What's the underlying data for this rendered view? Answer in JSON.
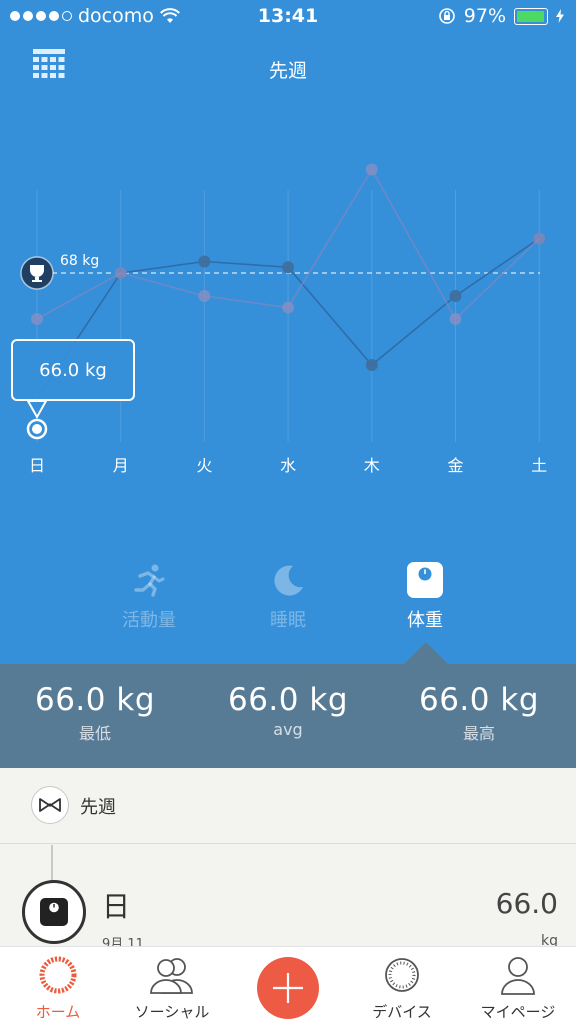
{
  "status_bar": {
    "carrier": "docomo",
    "time": "13:41",
    "battery": "97%",
    "battery_level": 0.97
  },
  "header": {
    "title": "先週",
    "calendar_icon": "calendar-grid-icon"
  },
  "chart_data": {
    "type": "line",
    "categories": [
      "日",
      "月",
      "火",
      "水",
      "木",
      "金",
      "土"
    ],
    "series": [
      {
        "values": [
          null,
          66.3,
          66.4,
          66.35,
          65.5,
          66.1,
          66.6
        ]
      },
      {
        "values": [
          65.9,
          66.3,
          66.1,
          66.0,
          67.2,
          65.9,
          66.6
        ]
      }
    ],
    "current_point": {
      "category": "日",
      "value": 66.0
    },
    "goal_value": 68,
    "goal_label": "68 kg",
    "goal_icon": "trophy-icon",
    "tooltip": "66.0 kg"
  },
  "categories_nav": [
    {
      "label": "活動量",
      "icon": "running-icon",
      "active": false
    },
    {
      "label": "睡眠",
      "icon": "moon-icon",
      "active": false
    },
    {
      "label": "体重",
      "icon": "scale-icon",
      "active": true
    }
  ],
  "stats": [
    {
      "value": "66.0 kg",
      "label": "最低"
    },
    {
      "value": "66.0 kg",
      "label": "avg"
    },
    {
      "value": "66.0 kg",
      "label": "最高"
    }
  ],
  "week_section": {
    "label": "先週",
    "icon": "bowtie-icon"
  },
  "entry": {
    "day": "日",
    "date": "9月 11",
    "value": "66.0",
    "unit": "kg",
    "icon": "scale-icon"
  },
  "tabbar": [
    {
      "label": "ホーム",
      "icon": "home-ring-icon",
      "active": true
    },
    {
      "label": "ソーシャル",
      "icon": "people-icon",
      "active": false
    },
    {
      "label": "",
      "icon": "plus-icon",
      "active": false
    },
    {
      "label": "デバイス",
      "icon": "device-ring-icon",
      "active": false
    },
    {
      "label": "マイページ",
      "icon": "person-icon",
      "active": false
    }
  ],
  "colors": {
    "header_blue": "#3590d9",
    "stats_bar": "#587b95",
    "accent_red": "#ee5b45"
  }
}
